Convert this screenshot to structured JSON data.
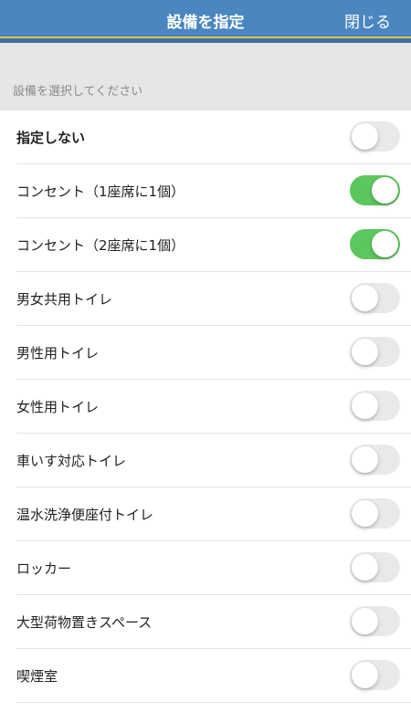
{
  "header": {
    "title": "設備を指定",
    "close_label": "閉じる"
  },
  "section": {
    "label": "設備を選択してください"
  },
  "colors": {
    "header": "#4a86bf",
    "toggle_on": "#5cc75d",
    "toggle_off": "#e9e9eb"
  },
  "items": [
    {
      "label": "指定しない",
      "on": false,
      "bold": true
    },
    {
      "label": "コンセント（1座席に1個）",
      "on": true
    },
    {
      "label": "コンセント（2座席に1個）",
      "on": true
    },
    {
      "label": "男女共用トイレ",
      "on": false
    },
    {
      "label": "男性用トイレ",
      "on": false
    },
    {
      "label": "女性用トイレ",
      "on": false
    },
    {
      "label": "車いす対応トイレ",
      "on": false
    },
    {
      "label": "温水洗浄便座付トイレ",
      "on": false
    },
    {
      "label": "ロッカー",
      "on": false
    },
    {
      "label": "大型荷物置きスペース",
      "on": false
    },
    {
      "label": "喫煙室",
      "on": false
    }
  ]
}
